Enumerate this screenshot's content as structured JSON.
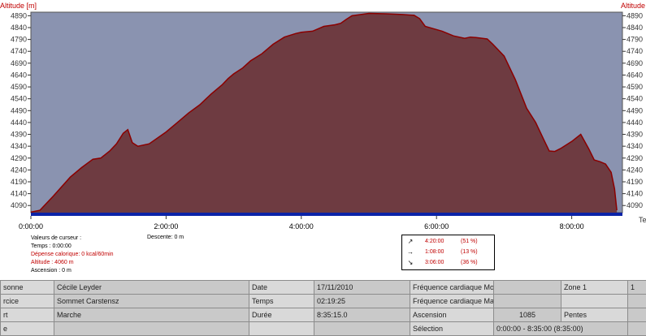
{
  "chart": {
    "y_title_left": "Altitude  [m]",
    "y_title_right": "Altitude",
    "x_title_right": "Te"
  },
  "chart_data": {
    "type": "area",
    "title": "",
    "xlabel": "",
    "ylabel": "Altitude  [m]",
    "xlim_minutes": [
      0,
      525
    ],
    "ylim": [
      4060,
      4905
    ],
    "grid": false,
    "fill_color": "#6e3b41",
    "line_color": "#8b0000",
    "plot_bg": "#8a93b0",
    "baseline_color": "#0b23a8",
    "x_minutes": [
      0,
      8,
      20,
      35,
      45,
      55,
      62,
      70,
      76,
      82,
      86,
      90,
      95,
      105,
      120,
      130,
      140,
      150,
      160,
      170,
      175,
      180,
      188,
      195,
      205,
      215,
      225,
      235,
      240,
      250,
      260,
      270,
      275,
      280,
      285,
      300,
      315,
      330,
      336,
      340,
      345,
      350,
      365,
      375,
      385,
      390,
      395,
      405,
      410,
      420,
      430,
      440,
      448,
      455,
      460,
      465,
      470,
      480,
      488,
      495,
      500,
      505,
      510,
      515,
      518,
      520
    ],
    "altitudes_m": [
      4062,
      4070,
      4130,
      4210,
      4250,
      4285,
      4290,
      4320,
      4350,
      4395,
      4410,
      4355,
      4340,
      4350,
      4400,
      4440,
      4480,
      4515,
      4560,
      4600,
      4625,
      4645,
      4670,
      4700,
      4730,
      4770,
      4800,
      4815,
      4820,
      4825,
      4845,
      4852,
      4858,
      4875,
      4890,
      4900,
      4898,
      4895,
      4893,
      4892,
      4878,
      4845,
      4825,
      4805,
      4795,
      4800,
      4798,
      4792,
      4770,
      4720,
      4620,
      4500,
      4440,
      4370,
      4320,
      4318,
      4330,
      4360,
      4390,
      4330,
      4282,
      4275,
      4265,
      4230,
      4160,
      4070
    ],
    "y_ticks": [
      4090,
      4140,
      4190,
      4240,
      4290,
      4340,
      4390,
      4440,
      4490,
      4540,
      4590,
      4640,
      4690,
      4740,
      4790,
      4840,
      4890
    ],
    "x_tick_minutes": [
      0,
      120,
      240,
      360,
      480
    ],
    "x_tick_labels": [
      "0:00:00",
      "2:00:00",
      "4:00:00",
      "6:00:00",
      "8:00:00"
    ]
  },
  "cursor": {
    "title": "Valeurs de curseur :",
    "time": "Temps : 0:00:00",
    "calories": "Dépense calorique: 0 kcal/60min",
    "altitude": "Altitude : 4060 m",
    "ascent": "Ascension : 0 m",
    "descent": "Descente: 0 m"
  },
  "slopes": [
    {
      "icon": "↗",
      "time": "4:20:00",
      "pct": "(51 %)"
    },
    {
      "icon": "→",
      "time": "1:08:00",
      "pct": "(13 %)"
    },
    {
      "icon": "↘",
      "time": "3:06:00",
      "pct": "(36 %)"
    }
  ],
  "table": {
    "r1": {
      "c1": "sonne",
      "c2": "Cécile Leyder",
      "c3": "Date",
      "c4": "17/11/2010",
      "c5": "Fréquence cardiaque Mo",
      "c6": "",
      "c7": "Zone 1",
      "c8": "1"
    },
    "r2": {
      "c1": "rcice",
      "c2": "Sommet Carstensz",
      "c3": "Temps",
      "c4": "02:19:25",
      "c5": "Fréquence cardiaque Ma",
      "c6": "",
      "c7": "",
      "c8": ""
    },
    "r3": {
      "c1": "rt",
      "c2": "Marche",
      "c3": "Durée",
      "c4": "8:35:15.0",
      "c5": "Ascension",
      "c6": "1085",
      "c7": "Pentes",
      "c8": ""
    },
    "r4": {
      "c1": "e",
      "c2": "",
      "c3": "",
      "c4": "",
      "c5": "Sélection",
      "c6": "0:00:00 - 8:35:00 (8:35:00)",
      "c7": "",
      "c8": ""
    }
  }
}
